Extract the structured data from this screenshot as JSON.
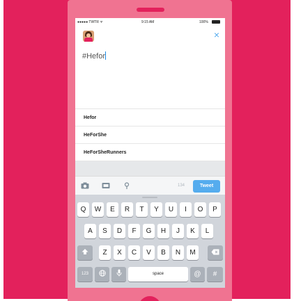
{
  "status_bar": {
    "carrier": "●●●●● TWTR ᯤ",
    "time": "9:15 AM",
    "battery_text": "100%"
  },
  "header": {
    "close_icon": "×"
  },
  "compose": {
    "text": "#Hefor"
  },
  "suggestions": [
    {
      "label": "Hefor"
    },
    {
      "label": "HeForShe"
    },
    {
      "label": "HeForSheRunners"
    }
  ],
  "toolbar": {
    "camera_icon": "📷",
    "gif_icon": "GIF",
    "location_icon": "⚲",
    "char_count": "134",
    "tweet_label": "Tweet"
  },
  "keyboard": {
    "row1": [
      "Q",
      "W",
      "E",
      "R",
      "T",
      "Y",
      "U",
      "I",
      "O",
      "P"
    ],
    "row2": [
      "A",
      "S",
      "D",
      "F",
      "G",
      "H",
      "J",
      "K",
      "L"
    ],
    "row3": [
      "Z",
      "X",
      "C",
      "V",
      "B",
      "N",
      "M"
    ],
    "shift_icon": "⇧",
    "delete_icon": "⌫",
    "numbers_label": "123",
    "globe_icon": "🌐",
    "mic_icon": "🎤",
    "space_label": "space",
    "at_label": "@",
    "hash_label": "#"
  },
  "colors": {
    "background": "#e3215c",
    "phone": "#f07391",
    "accent": "#55acee"
  }
}
